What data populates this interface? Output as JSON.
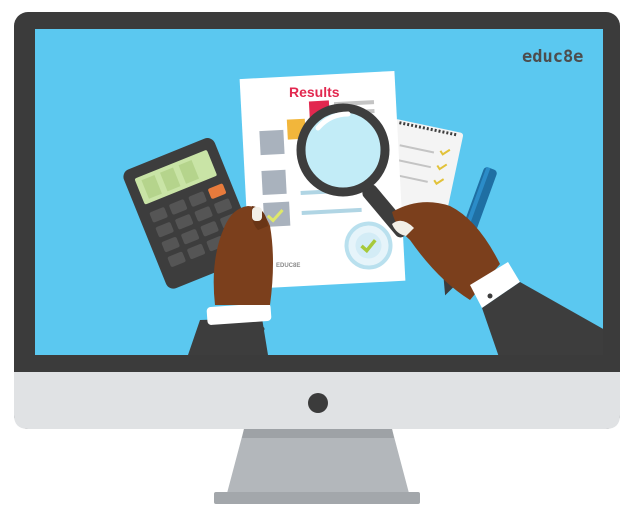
{
  "brand": {
    "name": "educ8e",
    "logo_icon": "educ8e-logo"
  },
  "document": {
    "heading": "Results",
    "footer_brand": "EDUC8E"
  },
  "colors": {
    "frame": "#3b3b3b",
    "screen": "#5bc8f0",
    "chin": "#e0e2e4",
    "stand": "#b3b7bb",
    "heading": "#e2284f",
    "skin": "#7b3f1c",
    "suit": "#3d3d3d",
    "lens": "#c2ecf7"
  },
  "icons": [
    "calculator-icon",
    "magnifier-icon",
    "notepad-icon",
    "pen-icon",
    "checkmark-badge-icon",
    "camera-dot-icon"
  ]
}
